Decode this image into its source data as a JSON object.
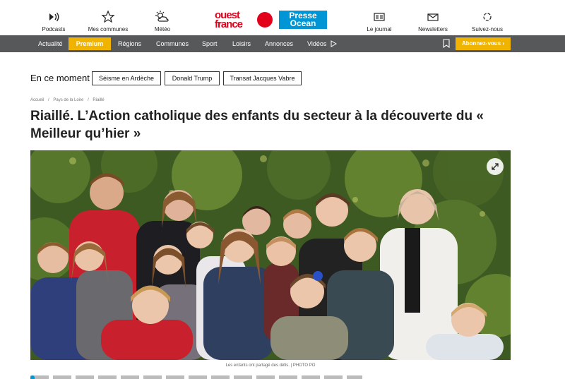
{
  "header": {
    "left_items": [
      {
        "label": "Podcasts",
        "icon": "podcast-icon"
      },
      {
        "label": "Mes communes",
        "icon": "star-icon"
      },
      {
        "label": "Météo",
        "icon": "weather-icon"
      }
    ],
    "right_items": [
      {
        "label": "Le journal",
        "icon": "newspaper-icon"
      },
      {
        "label": "Newsletters",
        "icon": "envelope-icon"
      },
      {
        "label": "Suivez-nous",
        "icon": "social-icon"
      }
    ],
    "logo_ouest_line1": "ouest",
    "logo_ouest_line2": "france",
    "logo_presse_line1": "Presse",
    "logo_presse_line2": "Ocean"
  },
  "nav": {
    "items": [
      "Actualité",
      "Premium",
      "Régions",
      "Communes",
      "Sport",
      "Loisirs",
      "Annonces",
      "Vidéos"
    ],
    "subscribe_label": "Abonnez-vous ›"
  },
  "moment": {
    "title": "En ce moment",
    "chips": [
      "Séisme en Ardèche",
      "Donald Trump",
      "Transat Jacques Vabre"
    ]
  },
  "breadcrumb": [
    "Accueil",
    "/",
    "Pays de la Loire",
    "/",
    "Riaillé"
  ],
  "article": {
    "headline": "Riaillé. L’Action catholique des enfants du secteur à la découverte du « Meilleur qu’hier »",
    "caption": "Les enfants ont partagé des défis. | PHOTO PO"
  },
  "colors": {
    "nav_bg": "#57585a",
    "accent": "#f0b400",
    "ouest_red": "#e2001a",
    "presse_blue": "#0096d6"
  }
}
